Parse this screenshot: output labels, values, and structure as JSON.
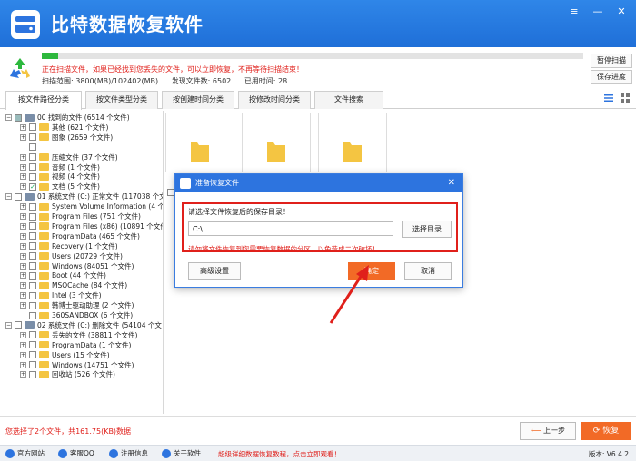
{
  "app": {
    "title": "比特数据恢复软件",
    "window_controls": [
      "≡",
      "—",
      "✕"
    ]
  },
  "scan": {
    "progress": 0.03,
    "status_text": "正在扫描文件，如果已经找到您丢失的文件，可以立即恢复，不再等待扫描结束！",
    "range_label": "扫描范围: 3800(MB)/102402(MB)",
    "found_label": "发现文件数: 6502",
    "time_label": "已用时间: 28",
    "pause_button": "暂停扫描",
    "save_progress_button": "保存进度"
  },
  "tabs": [
    {
      "label": "按文件路径分类",
      "active": true
    },
    {
      "label": "按文件类型分类",
      "active": false
    },
    {
      "label": "按创建时间分类",
      "active": false
    },
    {
      "label": "按修改时间分类",
      "active": false
    },
    {
      "label": "文件搜索",
      "active": false
    }
  ],
  "tree": [
    {
      "label": "00 找到的文件  (6514 个文件)",
      "level": 0,
      "exp": "−",
      "chk": "partial",
      "icon": "drive"
    },
    {
      "label": "其他    (621 个文件)",
      "level": 1,
      "exp": "+",
      "chk": "none",
      "icon": "folder"
    },
    {
      "label": "图象    (2659 个文件)",
      "level": 1,
      "exp": "+",
      "chk": "none",
      "icon": "folder"
    },
    {
      "label": "",
      "level": 1,
      "exp": "",
      "chk": "none",
      "icon": ""
    },
    {
      "label": "压缩文件    (37 个文件)",
      "level": 1,
      "exp": "+",
      "chk": "none",
      "icon": "folder"
    },
    {
      "label": "音频    (1 个文件)",
      "level": 1,
      "exp": "+",
      "chk": "none",
      "icon": "folder"
    },
    {
      "label": "视频    (4 个文件)",
      "level": 1,
      "exp": "+",
      "chk": "none",
      "icon": "folder"
    },
    {
      "label": "文档    (5 个文件)",
      "level": 1,
      "exp": "+",
      "chk": "checked",
      "icon": "folder"
    },
    {
      "label": "01 系统文件 (C:) 正常文件  (117038 个文",
      "level": 0,
      "exp": "−",
      "chk": "none",
      "icon": "drive"
    },
    {
      "label": "System Volume Information    (4 个文",
      "level": 1,
      "exp": "+",
      "chk": "none",
      "icon": "folder"
    },
    {
      "label": "Program Files    (751 个文件)",
      "level": 1,
      "exp": "+",
      "chk": "none",
      "icon": "folder"
    },
    {
      "label": "Program Files (x86)    (10891 个文件",
      "level": 1,
      "exp": "+",
      "chk": "none",
      "icon": "folder"
    },
    {
      "label": "ProgramData    (465 个文件)",
      "level": 1,
      "exp": "+",
      "chk": "none",
      "icon": "folder"
    },
    {
      "label": "Recovery    (1 个文件)",
      "level": 1,
      "exp": "+",
      "chk": "none",
      "icon": "folder"
    },
    {
      "label": "Users    (20729 个文件)",
      "level": 1,
      "exp": "+",
      "chk": "none",
      "icon": "folder"
    },
    {
      "label": "Windows    (84051 个文件)",
      "level": 1,
      "exp": "+",
      "chk": "none",
      "icon": "folder"
    },
    {
      "label": "Boot    (44 个文件)",
      "level": 1,
      "exp": "+",
      "chk": "none",
      "icon": "folder"
    },
    {
      "label": "MSOCache    (84 个文件)",
      "level": 1,
      "exp": "+",
      "chk": "none",
      "icon": "folder"
    },
    {
      "label": "Intel    (3 个文件)",
      "level": 1,
      "exp": "+",
      "chk": "none",
      "icon": "folder"
    },
    {
      "label": "韩博士驱动助理    (2 个文件)",
      "level": 1,
      "exp": "+",
      "chk": "none",
      "icon": "folder"
    },
    {
      "label": "360SANDBOX    (6 个文件)",
      "level": 1,
      "exp": "",
      "chk": "none",
      "icon": "folder"
    },
    {
      "label": "02 系统文件 (C:) 删除文件  (54104 个文",
      "level": 0,
      "exp": "−",
      "chk": "none",
      "icon": "drive"
    },
    {
      "label": "丢失的文件    (38811 个文件)",
      "level": 1,
      "exp": "+",
      "chk": "none",
      "icon": "folder"
    },
    {
      "label": "ProgramData    (1 个文件)",
      "level": 1,
      "exp": "+",
      "chk": "none",
      "icon": "folder"
    },
    {
      "label": "Users    (15 个文件)",
      "level": 1,
      "exp": "+",
      "chk": "none",
      "icon": "folder"
    },
    {
      "label": "Windows    (14751 个文件)",
      "level": 1,
      "exp": "+",
      "chk": "none",
      "icon": "folder"
    },
    {
      "label": "回收站    (526 个文件)",
      "level": 1,
      "exp": "+",
      "chk": "none",
      "icon": "folder"
    }
  ],
  "dialog": {
    "title": "准备恢复文件",
    "close": "✕",
    "prompt": "请选择文件恢复后的保存目录！",
    "path_value": "C:\\",
    "browse_button": "选择目录",
    "warning": "请勿将文件恢复到您需要恢复数据的分区，以免造成二次破坏！",
    "advanced_button": "高级设置",
    "ok_button": "确定",
    "cancel_button": "取消"
  },
  "bottom": {
    "selected_info": "您选择了2个文件，共161.75(KB)数据",
    "prev_button": "上一步",
    "recover_button": "恢复"
  },
  "footer": {
    "items": [
      "官方网站",
      "客服QQ",
      "注册信息",
      "关于软件"
    ],
    "promo": "超级详细数据恢复教程，点击立即观看！",
    "version": "版本: V6.4.2"
  },
  "colors": {
    "brand_blue": "#2d74df",
    "accent_orange": "#f26a26",
    "alert_red": "#e0201b",
    "progress_green": "#2db83d"
  }
}
